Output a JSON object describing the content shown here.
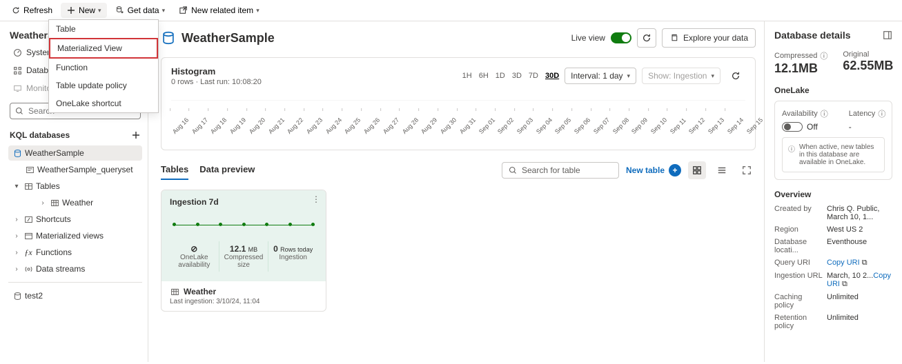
{
  "toolbar": {
    "refresh": "Refresh",
    "new": "New",
    "get_data": "Get data",
    "new_related": "New related item",
    "new_menu": [
      "Table",
      "Materialized View",
      "Function",
      "Table update policy",
      "OneLake shortcut"
    ],
    "new_menu_highlight_index": 1
  },
  "sidebar": {
    "title": "WeatherSa…",
    "items": [
      "System overview",
      "Databases",
      "Monitoring"
    ],
    "search_placeholder": "Search",
    "db_section": "KQL databases",
    "dbs": {
      "name": "WeatherSample",
      "queryset": "WeatherSample_queryset",
      "folders": [
        "Tables",
        "Shortcuts",
        "Materialized views",
        "Functions",
        "Data streams"
      ],
      "tables": [
        "Weather"
      ],
      "other_db": "test2"
    }
  },
  "main": {
    "title": "WeatherSample",
    "live_view": "Live view",
    "explore": "Explore your data",
    "histogram": {
      "title": "Histogram",
      "sub": "0 rows · Last run: 10:08:20",
      "ranges": [
        "1H",
        "6H",
        "1D",
        "3D",
        "7D",
        "30D"
      ],
      "range_selected": "30D",
      "interval": "Interval: 1 day",
      "show": "Show: Ingestion",
      "ticks": [
        "Aug 16",
        "Aug 17",
        "Aug 18",
        "Aug 19",
        "Aug 20",
        "Aug 21",
        "Aug 22",
        "Aug 23",
        "Aug 24",
        "Aug 25",
        "Aug 26",
        "Aug 27",
        "Aug 28",
        "Aug 29",
        "Aug 30",
        "Aug 31",
        "Sep 01",
        "Sep 02",
        "Sep 03",
        "Sep 04",
        "Sep 05",
        "Sep 06",
        "Sep 07",
        "Sep 08",
        "Sep 09",
        "Sep 10",
        "Sep 11",
        "Sep 12",
        "Sep 13",
        "Sep 14",
        "Sep 15"
      ]
    },
    "tabs": [
      "Tables",
      "Data preview"
    ],
    "search_table_ph": "Search for table",
    "new_table": "New table",
    "tile": {
      "title": "Ingestion 7d",
      "onelake_lbl": "OneLake availability",
      "onelake_val": "⊘",
      "size_lbl": "Compressed size",
      "size_val": "12.1",
      "size_unit": "MB",
      "rows_lbl": "Ingestion",
      "rows_val": "0",
      "rows_suffix": "Rows today",
      "table": "Weather",
      "last": "Last ingestion: 3/10/24, 11:04"
    }
  },
  "right": {
    "header": "Database details",
    "compressed_lbl": "Compressed",
    "compressed_val": "12.1MB",
    "original_lbl": "Original",
    "original_val": "62.55MB",
    "onelake_header": "OneLake",
    "availability": "Availability",
    "avail_state": "Off",
    "latency": "Latency",
    "latency_val": "-",
    "info": "When active, new tables in this database are available in OneLake.",
    "overview_header": "Overview",
    "kv": [
      {
        "k": "Created by",
        "v": "Chris Q. Public, March 10, 1..."
      },
      {
        "k": "Region",
        "v": "West US 2"
      },
      {
        "k": "Database locati...",
        "v": "Eventhouse"
      },
      {
        "k": "Query URI",
        "v": "Copy URI",
        "link": true,
        "copy": true
      },
      {
        "k": "Ingestion URL",
        "v": "March, 10 2...",
        "link2": "Copy URI",
        "copy": true
      },
      {
        "k": "Caching policy",
        "v": "Unlimited"
      },
      {
        "k": "Retention policy",
        "v": "Unlimited"
      }
    ]
  }
}
